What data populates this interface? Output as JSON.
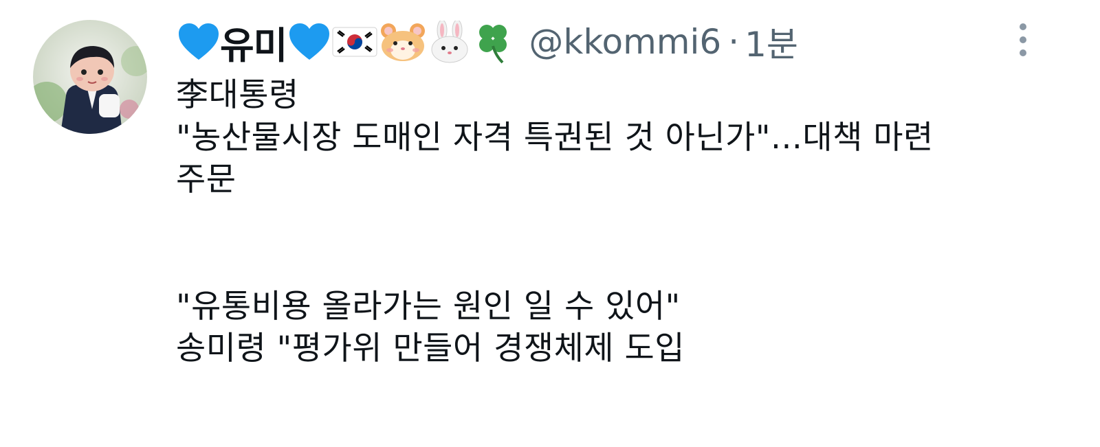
{
  "author": {
    "display_name": "유미",
    "handle": "@kkommi6",
    "separator": "·",
    "timestamp": "1분",
    "name_emojis": [
      "blue-heart",
      "blue-heart",
      "korea-flag",
      "hamster-face",
      "rabbit-face",
      "four-leaf-clover"
    ],
    "avatar_icon": "avatar-image"
  },
  "menu": {
    "icon": "more-vertical-icon"
  },
  "tweet": {
    "lines": [
      "李대통령",
      "\"농산물시장 도매인 자격 특권된 것 아닌가\"...대책 마련",
      "주문",
      "\"유통비용 올라가는 원인 일 수 있어\"",
      "송미령 \"평가위 만들어 경쟁체제 도입"
    ]
  },
  "colors": {
    "text": "#0f1419",
    "muted": "#536471",
    "heart": "#1d9bf0",
    "background": "#ffffff"
  }
}
